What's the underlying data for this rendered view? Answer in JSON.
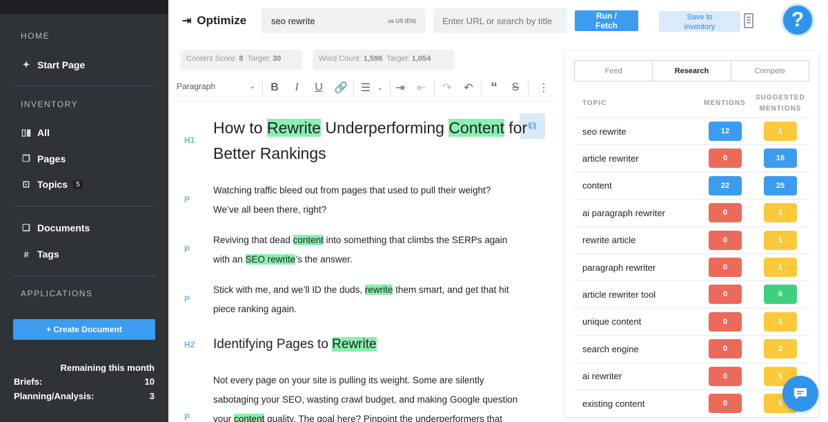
{
  "sidebar": {
    "home_section": "HOME",
    "start_page": "Start Page",
    "inventory_section": "INVENTORY",
    "all": "All",
    "pages": "Pages",
    "topics": "Topics",
    "topics_count": "5",
    "documents": "Documents",
    "tags": "Tags",
    "applications_section": "APPLICATIONS",
    "create_document": "+ Create Document",
    "remaining_label": "Remaining this month",
    "briefs_label": "Briefs:",
    "briefs_value": "10",
    "planning_label": "Planning/Analysis:",
    "planning_value": "3"
  },
  "header": {
    "title": "Optimize",
    "keyword": "seo rewrite",
    "locale": "us  US (EN)",
    "url_placeholder": "Enter URL or search by title",
    "run_line1": "Run /",
    "run_line2": "Fetch",
    "save_line1": "Save to",
    "save_line2": "inventory",
    "help": "?"
  },
  "scores": {
    "content_score_label": "Content Score:",
    "content_score": "8",
    "content_target_label": "Target:",
    "content_target": "30",
    "word_count_label": "Word Count:",
    "word_count": "1,598",
    "word_target_label": "Target:",
    "word_target": "1,054"
  },
  "toolbar": {
    "paragraph": "Paragraph"
  },
  "editor": {
    "h1_tag": "H1",
    "h1_a": "How to ",
    "h1_b": "Rewrite",
    "h1_c": " Underperforming ",
    "h1_d": "Content",
    "h1_e": " for Better Rankings",
    "p1_tag": "P",
    "p1_a": "Watching traffic bleed out from pages that used to pull their weight?",
    "p1_b": "We’ve all been there, right?",
    "p2_tag": "P",
    "p2_a": "Reviving that dead ",
    "p2_b": "content",
    "p2_c": " into something that climbs the SERPs again with an ",
    "p2_d": "SEO rewrite",
    "p2_e": "’s the answer.",
    "p3_tag": "P",
    "p3_a": "Stick with me, and we’ll ID the duds, ",
    "p3_b": "rewrite",
    "p3_c": " them smart, and get that hit piece ranking again.",
    "h2_tag": "H2",
    "h2_a": "Identifying Pages to ",
    "h2_b": "Rewrite",
    "p4_tag": "P",
    "p4_a": "Not every page on your site is pulling its weight. Some are silently sabotaging your SEO, wasting crawl budget, and making Google question your ",
    "p4_b": "content",
    "p4_c": " quality. The goal here? Pinpoint the underperformers that"
  },
  "panel": {
    "tabs": [
      "Feed",
      "Research",
      "Compete"
    ],
    "col_topic": "TOPIC",
    "col_mentions": "MENTIONS",
    "col_suggested_1": "SUGGESTED",
    "col_suggested_2": "MENTIONS",
    "rows": [
      {
        "topic": "seo rewrite",
        "mentions": "12",
        "suggested": "1"
      },
      {
        "topic": "article rewriter",
        "mentions": "0",
        "suggested": "16"
      },
      {
        "topic": "content",
        "mentions": "22",
        "suggested": "25"
      },
      {
        "topic": "ai paragraph rewriter",
        "mentions": "0",
        "suggested": "1"
      },
      {
        "topic": "rewrite article",
        "mentions": "0",
        "suggested": "1"
      },
      {
        "topic": "paragraph rewriter",
        "mentions": "0",
        "suggested": "1"
      },
      {
        "topic": "article rewriter tool",
        "mentions": "0",
        "suggested": "6"
      },
      {
        "topic": "unique content",
        "mentions": "0",
        "suggested": "1"
      },
      {
        "topic": "search engine",
        "mentions": "0",
        "suggested": "2"
      },
      {
        "topic": "ai rewriter",
        "mentions": "0",
        "suggested": "1"
      },
      {
        "topic": "existing content",
        "mentions": "0",
        "suggested": "1"
      }
    ]
  },
  "colors": {
    "blue": "#3b9cf0",
    "red": "#ec6a5a",
    "yellow": "#fcc93a",
    "green": "#3fcf80"
  }
}
